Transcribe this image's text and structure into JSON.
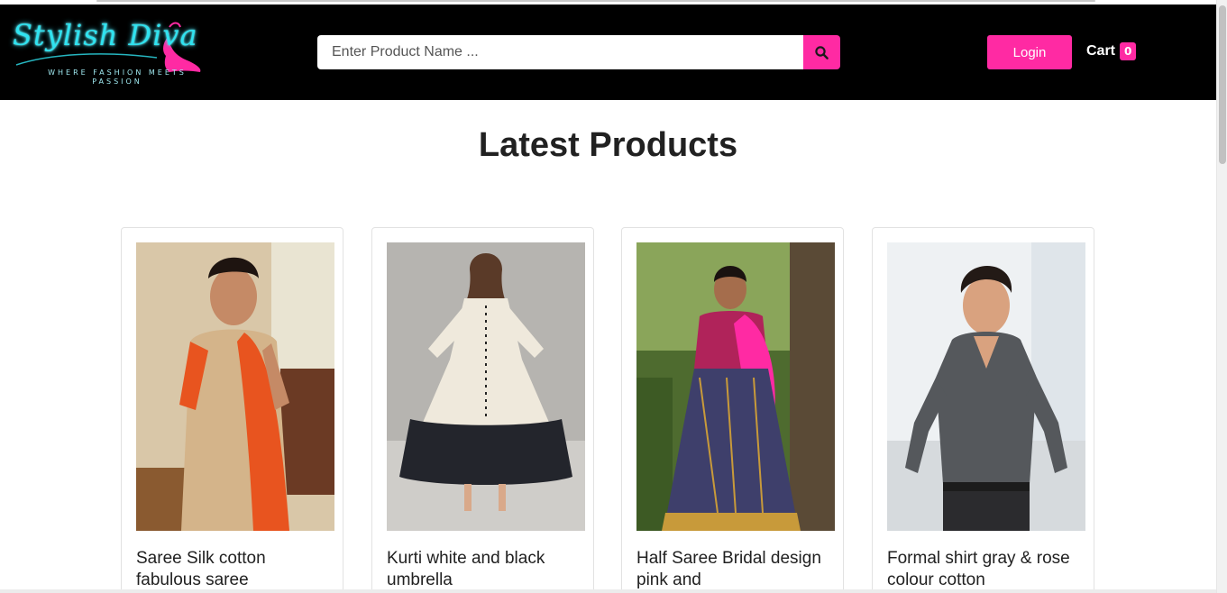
{
  "header": {
    "logo_text": "Stylish Diva",
    "logo_tagline": "WHERE FASHION MEETS PASSION",
    "search_placeholder": "Enter Product Name ...",
    "search_icon": "search-icon",
    "login_label": "Login",
    "cart_label": "Cart",
    "cart_count": "0"
  },
  "main": {
    "title": "Latest Products",
    "products": [
      {
        "name": "Saree Silk cotton fabulous saree",
        "image": "woman-in-saree-photo"
      },
      {
        "name": "Kurti white and black umbrella",
        "image": "woman-in-kurti-photo"
      },
      {
        "name": "Half Saree Bridal design pink and",
        "image": "woman-in-half-saree-photo"
      },
      {
        "name": "Formal shirt gray & rose colour cotton",
        "image": "man-in-shirt-photo"
      }
    ]
  },
  "colors": {
    "accent": "#ff2aa3",
    "navbar": "#000000",
    "logo_neon": "#2fe3f0"
  }
}
